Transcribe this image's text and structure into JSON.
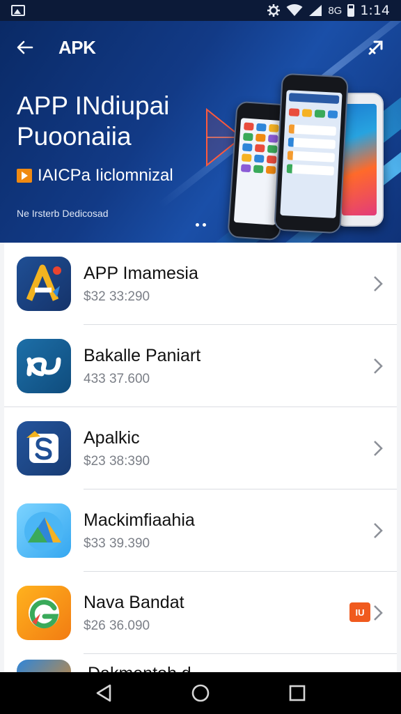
{
  "status_bar": {
    "indicators": "8G",
    "time": "1:14",
    "icons": [
      "image-icon",
      "settings-icon",
      "wifi-icon",
      "signal-icon",
      "battery-icon"
    ]
  },
  "header": {
    "brand": "APK",
    "icons": [
      "back-arrow-icon",
      "share-icon"
    ]
  },
  "hero": {
    "title_line1": "APP INdiupai",
    "title_line2": "Puoonaiia",
    "subtitle": "IAICPa Iiclomnizal",
    "caption": "Ne Irsterb Dedicosad",
    "accent_color": "#f08a12"
  },
  "apps": [
    {
      "name": "APP Imamesia",
      "sub": "$32 33:290",
      "icon": "app-a-icon"
    },
    {
      "name": "Bakalle Paniart",
      "sub": "433 37.600",
      "icon": "app-link-icon"
    },
    {
      "name": "Apalkic",
      "sub": "$23 38:390",
      "icon": "app-s-icon"
    },
    {
      "name": "Mackimfiaahia",
      "sub": "$33 39.390",
      "icon": "app-triangle-icon"
    },
    {
      "name": "Nava Bandat",
      "sub": "$26 36.090",
      "icon": "app-g-icon",
      "badge": "IU"
    }
  ],
  "partial_item": {
    "name": "Dakmentoh d"
  },
  "navbar": {
    "icons": [
      "back-triangle-icon",
      "home-circle-icon",
      "recents-square-icon"
    ]
  }
}
